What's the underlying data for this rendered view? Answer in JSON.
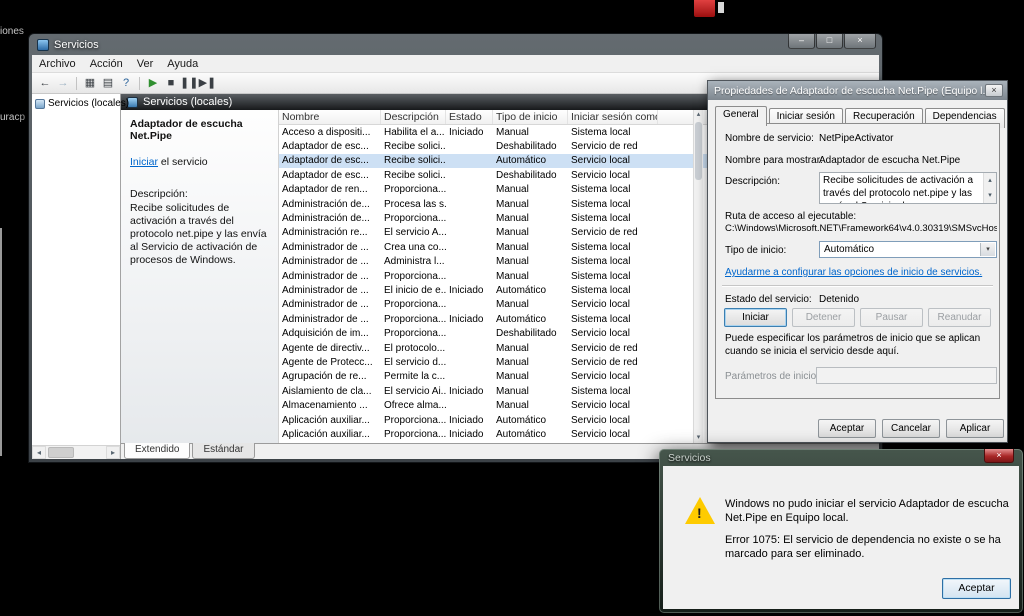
{
  "glyphs": {
    "minimize": "–",
    "maximize": "□",
    "close": "×",
    "up": "▴",
    "down": "▾",
    "left": "◂",
    "right": "▸",
    "dropdown": "▾",
    "warning": "!"
  },
  "colors": {
    "selection": "#CDE0F4",
    "link": "#0066CC",
    "warning_icon": "#FECB00"
  },
  "desktop": {
    "fragment_text_1": "iones",
    "fragment_text_2": "uracp"
  },
  "main_window": {
    "title": "Servicios",
    "menu": [
      {
        "name": "menu-archivo",
        "label": "Archivo"
      },
      {
        "name": "menu-accion",
        "label": "Acción"
      },
      {
        "name": "menu-ver",
        "label": "Ver"
      },
      {
        "name": "menu-ayuda",
        "label": "Ayuda"
      }
    ],
    "toolbar": [
      {
        "name": "back-icon",
        "glyph": "←",
        "cls": "dark"
      },
      {
        "name": "forward-icon",
        "glyph": "→",
        "cls": "dim"
      },
      {
        "name": "toolbar-separator",
        "glyph": "",
        "sep": true,
        "interactable": false
      },
      {
        "name": "show-console-tree-icon",
        "glyph": "▦",
        "cls": "dark"
      },
      {
        "name": "export-list-icon",
        "glyph": "▤",
        "cls": "dark"
      },
      {
        "name": "help-icon",
        "glyph": "?",
        "cls": ""
      },
      {
        "name": "toolbar-separator",
        "glyph": "",
        "sep": true,
        "interactable": false
      },
      {
        "name": "start-service-icon",
        "glyph": "▶",
        "cls": "green"
      },
      {
        "name": "stop-service-icon",
        "glyph": "■",
        "cls": "dark"
      },
      {
        "name": "pause-service-icon",
        "glyph": "❚❚",
        "cls": "dark"
      },
      {
        "name": "restart-service-icon",
        "glyph": "▶❚",
        "cls": "dark"
      }
    ],
    "tree_root": "Servicios (locales)",
    "banner": "Servicios (locales)",
    "detail": {
      "service_title": "Adaptador de escucha Net.Pipe",
      "start_link": "Iniciar",
      "start_suffix": " el servicio",
      "description_label": "Descripción:",
      "description": "Recibe solicitudes de activación a través del protocolo net.pipe y las envía al Servicio de activación de procesos de Windows."
    },
    "table": {
      "columns": [
        "Nombre",
        "Descripción",
        "Estado",
        "Tipo de inicio",
        "Iniciar sesión como"
      ],
      "rows": [
        {
          "name": "Acceso a dispositi...",
          "desc": "Habilita el a...",
          "state": "Iniciado",
          "startup": "Manual",
          "logon": "Sistema local"
        },
        {
          "name": "Adaptador de esc...",
          "desc": "Recibe solici...",
          "state": "",
          "startup": "Deshabilitado",
          "logon": "Servicio de red"
        },
        {
          "name": "Adaptador de esc...",
          "desc": "Recibe solici...",
          "state": "",
          "startup": "Automático",
          "logon": "Servicio local",
          "selected": true
        },
        {
          "name": "Adaptador de esc...",
          "desc": "Recibe solici...",
          "state": "",
          "startup": "Deshabilitado",
          "logon": "Servicio local"
        },
        {
          "name": "Adaptador de ren...",
          "desc": "Proporciona...",
          "state": "",
          "startup": "Manual",
          "logon": "Sistema local"
        },
        {
          "name": "Administración de...",
          "desc": "Procesa las s...",
          "state": "",
          "startup": "Manual",
          "logon": "Sistema local"
        },
        {
          "name": "Administración de...",
          "desc": "Proporciona...",
          "state": "",
          "startup": "Manual",
          "logon": "Sistema local"
        },
        {
          "name": "Administración re...",
          "desc": "El servicio A...",
          "state": "",
          "startup": "Manual",
          "logon": "Servicio de red"
        },
        {
          "name": "Administrador de ...",
          "desc": "Crea una co...",
          "state": "",
          "startup": "Manual",
          "logon": "Sistema local"
        },
        {
          "name": "Administrador de ...",
          "desc": "Administra l...",
          "state": "",
          "startup": "Manual",
          "logon": "Sistema local"
        },
        {
          "name": "Administrador de ...",
          "desc": "Proporciona...",
          "state": "",
          "startup": "Manual",
          "logon": "Sistema local"
        },
        {
          "name": "Administrador de ...",
          "desc": "El inicio de e...",
          "state": "Iniciado",
          "startup": "Automático",
          "logon": "Sistema local"
        },
        {
          "name": "Administrador de ...",
          "desc": "Proporciona...",
          "state": "",
          "startup": "Manual",
          "logon": "Servicio local"
        },
        {
          "name": "Administrador de ...",
          "desc": "Proporciona...",
          "state": "Iniciado",
          "startup": "Automático",
          "logon": "Sistema local"
        },
        {
          "name": "Adquisición de im...",
          "desc": "Proporciona...",
          "state": "",
          "startup": "Deshabilitado",
          "logon": "Servicio local"
        },
        {
          "name": "Agente de directiv...",
          "desc": "El protocolo...",
          "state": "",
          "startup": "Manual",
          "logon": "Servicio de red"
        },
        {
          "name": "Agente de Protecc...",
          "desc": "El servicio d...",
          "state": "",
          "startup": "Manual",
          "logon": "Servicio de red"
        },
        {
          "name": "Agrupación de re...",
          "desc": "Permite la c...",
          "state": "",
          "startup": "Manual",
          "logon": "Servicio local"
        },
        {
          "name": "Aislamiento de cla...",
          "desc": "El servicio Ai...",
          "state": "Iniciado",
          "startup": "Manual",
          "logon": "Sistema local"
        },
        {
          "name": "Almacenamiento ...",
          "desc": "Ofrece alma...",
          "state": "",
          "startup": "Manual",
          "logon": "Servicio local"
        },
        {
          "name": "Aplicación auxiliar...",
          "desc": "Proporciona...",
          "state": "Iniciado",
          "startup": "Automático",
          "logon": "Servicio local"
        },
        {
          "name": "Aplicación auxiliar...",
          "desc": "Proporciona...",
          "state": "Iniciado",
          "startup": "Automático",
          "logon": "Servicio local"
        }
      ]
    },
    "view_tabs": [
      {
        "name": "tab-extendido",
        "label": "Extendido",
        "active": true
      },
      {
        "name": "tab-estandar",
        "label": "Estándar"
      }
    ]
  },
  "properties_dialog": {
    "title": "Propiedades de Adaptador de escucha Net.Pipe (Equipo l...",
    "tabs": [
      {
        "name": "tab-general",
        "label": "General",
        "active": true
      },
      {
        "name": "tab-iniciar-sesion",
        "label": "Iniciar sesión"
      },
      {
        "name": "tab-recuperacion",
        "label": "Recuperación"
      },
      {
        "name": "tab-dependencias",
        "label": "Dependencias"
      }
    ],
    "fields": {
      "service_name_label": "Nombre de servicio:",
      "service_name_value": "NetPipeActivator",
      "display_name_label": "Nombre para mostrar:",
      "display_name_value": "Adaptador de escucha Net.Pipe",
      "description_label": "Descripción:",
      "description_value": "Recibe solicitudes de activación a través del protocolo net.pipe y las envía al Servicio de",
      "exe_path_label": "Ruta de acceso al ejecutable:",
      "exe_path_value": "C:\\Windows\\Microsoft.NET\\Framework64\\v4.0.30319\\SMSvcHost.exe",
      "startup_type_label": "Tipo de inicio:",
      "startup_type_value": "Automático",
      "help_link": "Ayudarme a configurar las opciones de inicio de servicios.",
      "service_status_label": "Estado del servicio:",
      "service_status_value": "Detenido",
      "params_note": "Puede especificar los parámetros de inicio que se aplican cuando se inicia el servicio desde aquí.",
      "params_label": "Parámetros de inicio:"
    },
    "service_buttons": [
      {
        "name": "start-service-button",
        "label": "Iniciar"
      },
      {
        "name": "stop-service-button",
        "label": "Detener",
        "disabled": true
      },
      {
        "name": "pause-service-button",
        "label": "Pausar",
        "disabled": true
      },
      {
        "name": "resume-service-button",
        "label": "Reanudar",
        "disabled": true
      }
    ],
    "bottom_buttons": [
      {
        "name": "accept-button",
        "label": "Aceptar"
      },
      {
        "name": "cancel-button",
        "label": "Cancelar"
      },
      {
        "name": "apply-button",
        "label": "Aplicar"
      }
    ]
  },
  "error_dialog": {
    "title": "Servicios",
    "message_line1": "Windows no pudo iniciar el servicio Adaptador de escucha Net.Pipe en Equipo local.",
    "message_line2": "Error 1075: El servicio de dependencia no existe o se ha marcado para ser eliminado.",
    "ok_button": "Aceptar"
  }
}
